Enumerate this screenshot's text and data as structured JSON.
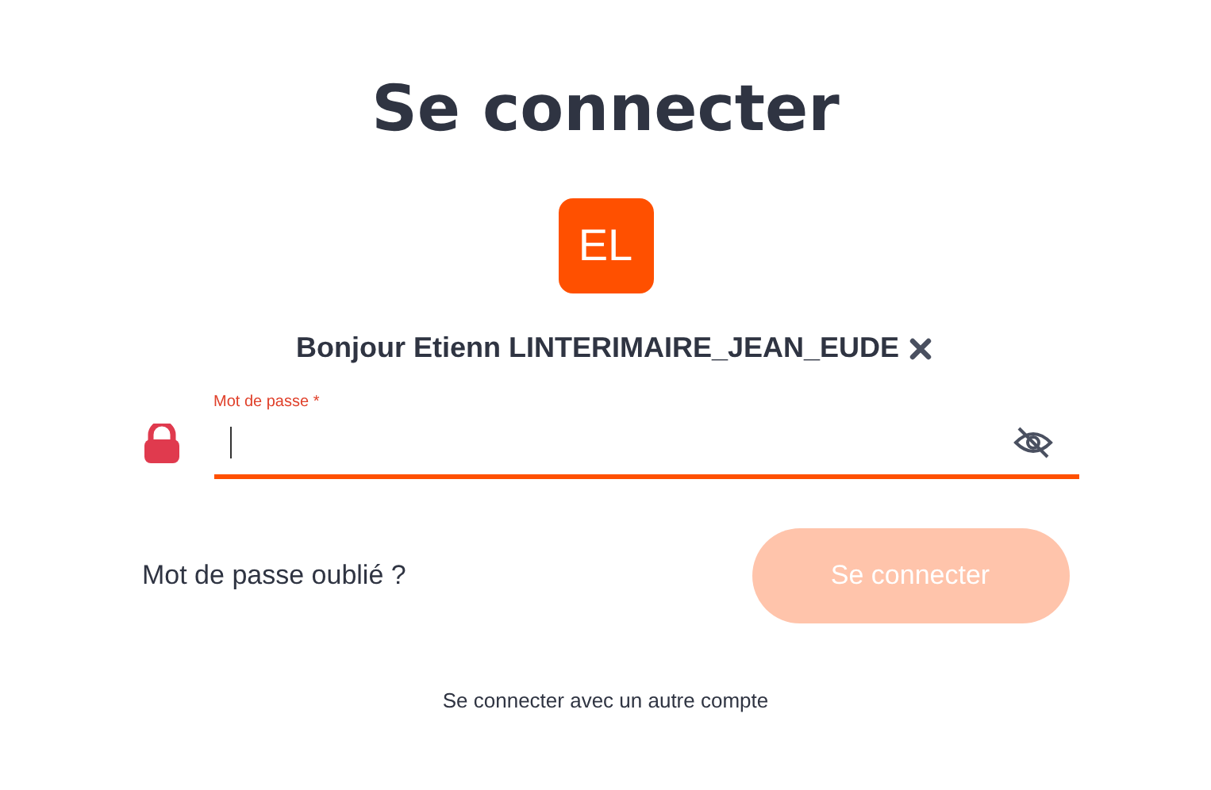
{
  "title": "Se connecter",
  "avatar": {
    "initials": "EL"
  },
  "greeting": "Bonjour Etienn LINTERIMAIRE_JEAN_EUDE",
  "password": {
    "label": "Mot de passe *",
    "focused": true
  },
  "forgot_link": "Mot de passe oublié ?",
  "submit": {
    "label": "Se connecter",
    "disabled": true
  },
  "other_account_link": "Se connecter avec un autre compte"
}
